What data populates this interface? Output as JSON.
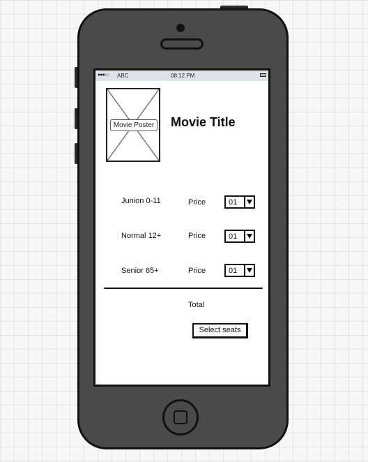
{
  "status_bar": {
    "signal": "●●●○○",
    "carrier": "ABC",
    "time": "08:12 PM",
    "battery_icon": "battery-icon"
  },
  "movie": {
    "poster_label": "Movie Poster",
    "title": "Movie Title"
  },
  "tickets": [
    {
      "label": "Junion 0-11",
      "price_label": "Price",
      "quantity": "01"
    },
    {
      "label": "Normal 12+",
      "price_label": "Price",
      "quantity": "01"
    },
    {
      "label": "Senior 65+",
      "price_label": "Price",
      "quantity": "01"
    }
  ],
  "summary": {
    "total_label": "Total",
    "select_button": "Select seats"
  },
  "colors": {
    "device_body": "#4a4a4a",
    "status_bar": "#dfe3e7",
    "outline": "#111111"
  }
}
